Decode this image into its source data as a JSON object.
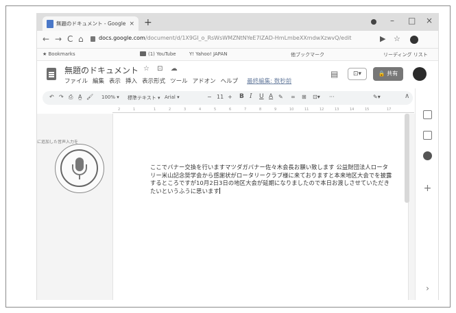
{
  "browser": {
    "tab_title": "無題のドキュメント - Google ドキュ",
    "tab_close": "×",
    "new_tab": "+",
    "window_controls": [
      "–",
      "□",
      "×"
    ],
    "nav": {
      "back": "←",
      "forward": "→",
      "reload": "C",
      "home": "⌂"
    },
    "url_host": "docs.google.com",
    "url_path": "/document/d/1X9GI_o_RsWsWMZNtNYeE7lZAD-HmLmbeXXmdwXzwvQ/edit",
    "addr_icons": [
      "▶",
      "☆"
    ],
    "bookmarks": [
      {
        "label": "★ Bookmarks"
      },
      {
        "label": "(1) YouTube"
      },
      {
        "label": "Y! Yahoo! JAPAN"
      },
      {
        "label": "他ブックマーク"
      },
      {
        "label": "リーディング リスト"
      }
    ]
  },
  "docs": {
    "title": "無題のドキュメント",
    "title_icons": "☆ ⊡ ☁",
    "menus": [
      "ファイル",
      "編集",
      "表示",
      "挿入",
      "表示形式",
      "ツール",
      "アドオン",
      "ヘルプ"
    ],
    "last_edit": "最終編集: 数秒前",
    "comment_icon": "▤",
    "present_label": "⊡▾",
    "share_label": "🔒 共有",
    "toolbar": {
      "undo": "↶",
      "redo": "↷",
      "print": "⎙",
      "spell": "A̲",
      "paint": "🖌",
      "zoom": "100% ▾",
      "style": "標準テキスト ▾",
      "font": "Arial ▾",
      "minus": "−",
      "font_size": "11",
      "plus": "+",
      "bold": "B",
      "italic": "I",
      "underline": "U",
      "text_color": "A",
      "highlight": "✎",
      "link": "∞",
      "comment": "⊞",
      "image": "⊡▾",
      "more": "···",
      "edit_mode": "✎▾",
      "collapse": "∧"
    },
    "ruler_ticks": [
      "2",
      "1",
      "1",
      "2",
      "3",
      "4",
      "5",
      "6",
      "7",
      "8",
      "9",
      "10",
      "11",
      "12",
      "13",
      "14",
      "15",
      "17"
    ],
    "voice_tip": "に追加した音声入力を",
    "body_text": "ここでバナー交換を行いますマツダガバナー佐々木会長お願い致します 公益財団法人ロータリー米山記念奨学会から感謝状がロータリークラブ様に来ておりますと本来地区大会でを披露するところですが10月2日3日の地区大会が延期になりましたので本日お渡しさせていただきたいというふうに思います"
  },
  "side_panel": {
    "add": "+",
    "expand": "›"
  }
}
